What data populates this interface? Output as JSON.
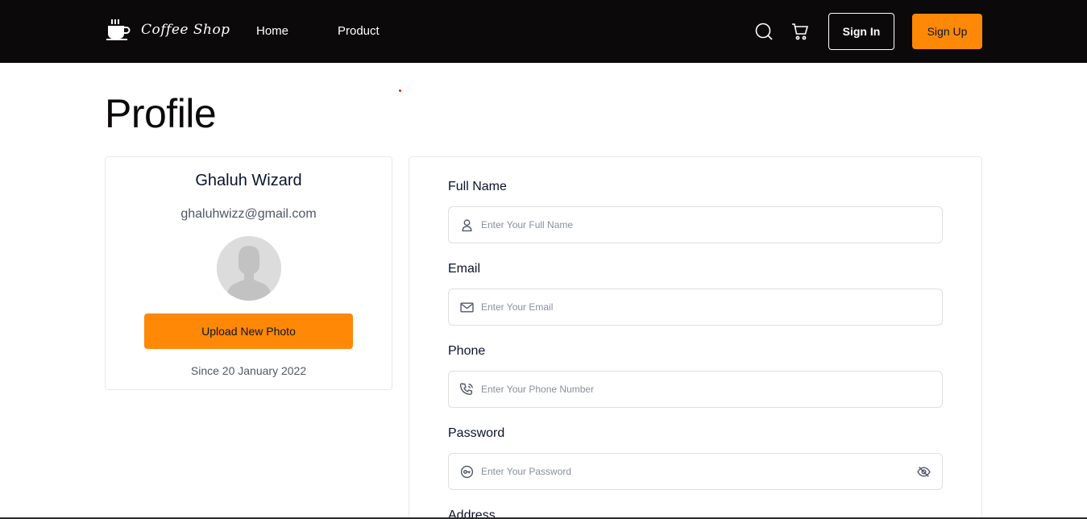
{
  "nav": {
    "brand": "Coffee Shop",
    "links": [
      "Home",
      "Product"
    ],
    "sign_in": "Sign In",
    "sign_up": "Sign Up"
  },
  "page": {
    "title": "Profile"
  },
  "profile": {
    "name": "Ghaluh Wizard",
    "email": "ghaluhwizz@gmail.com",
    "upload_label": "Upload New Photo",
    "since": "Since 20 January 2022"
  },
  "form": {
    "fields": [
      {
        "label": "Full Name",
        "placeholder": "Enter Your Full Name",
        "icon": "user-icon"
      },
      {
        "label": "Email",
        "placeholder": "Enter Your Email",
        "icon": "mail-icon"
      },
      {
        "label": "Phone",
        "placeholder": "Enter Your Phone Number",
        "icon": "phone-icon"
      },
      {
        "label": "Password",
        "placeholder": "Enter Your Password",
        "icon": "password-icon",
        "toggle_icon": "eye-off-icon"
      },
      {
        "label": "Address"
      }
    ]
  },
  "colors": {
    "accent": "#ff8906",
    "navbar": "#0b0909",
    "text": "#0b132a",
    "muted": "#4f5665"
  }
}
